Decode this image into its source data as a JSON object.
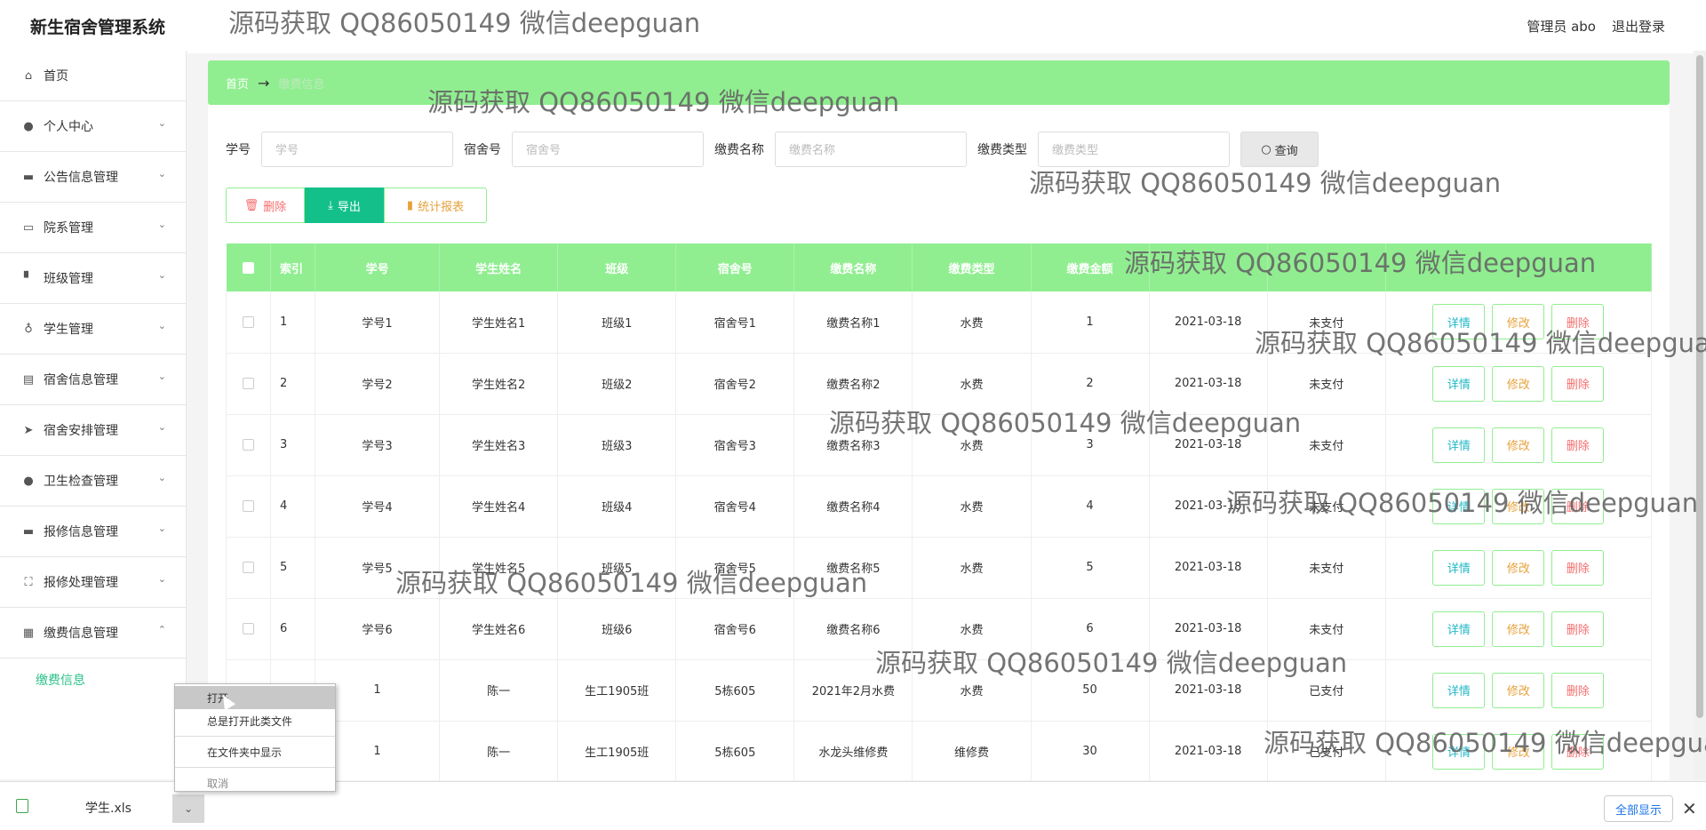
{
  "app_title": "新生宿舍管理系统",
  "header": {
    "user": "管理员 abo",
    "logout": "退出登录"
  },
  "sidebar": {
    "items": [
      {
        "label": "首页",
        "icon": "home-icon"
      },
      {
        "label": "个人中心",
        "icon": "user-icon"
      },
      {
        "label": "公告信息管理",
        "icon": "message-icon"
      },
      {
        "label": "院系管理",
        "icon": "id-card-icon"
      },
      {
        "label": "班级管理",
        "icon": "stamp-icon"
      },
      {
        "label": "学生管理",
        "icon": "microphone-icon"
      },
      {
        "label": "宿舍信息管理",
        "icon": "clipboard-icon"
      },
      {
        "label": "宿舍安排管理",
        "icon": "send-icon"
      },
      {
        "label": "卫生检查管理",
        "icon": "bulb-icon"
      },
      {
        "label": "报修信息管理",
        "icon": "monitor-icon"
      },
      {
        "label": "报修处理管理",
        "icon": "fullscreen-icon"
      },
      {
        "label": "缴费信息管理",
        "icon": "grid-icon"
      }
    ],
    "submenu": "缴费信息"
  },
  "breadcrumb": {
    "home": "首页",
    "separator": "→",
    "current": "缴费信息"
  },
  "search": {
    "fields": [
      {
        "label": "学号",
        "placeholder": "学号"
      },
      {
        "label": "宿舍号",
        "placeholder": "宿舍号"
      },
      {
        "label": "缴费名称",
        "placeholder": "缴费名称"
      },
      {
        "label": "缴费类型",
        "placeholder": "缴费类型"
      }
    ],
    "query_button": "查询"
  },
  "actions": {
    "delete": "删除",
    "export": "导出",
    "stats": "统计报表"
  },
  "table": {
    "headers": [
      "索引",
      "学号",
      "学生姓名",
      "班级",
      "宿舍号",
      "缴费名称",
      "缴费类型",
      "缴费金额",
      "",
      "",
      ""
    ],
    "rows": [
      [
        "1",
        "学号1",
        "学生姓名1",
        "班级1",
        "宿舍号1",
        "缴费名称1",
        "水费",
        "1",
        "2021-03-18",
        "未支付"
      ],
      [
        "2",
        "学号2",
        "学生姓名2",
        "班级2",
        "宿舍号2",
        "缴费名称2",
        "水费",
        "2",
        "2021-03-18",
        "未支付"
      ],
      [
        "3",
        "学号3",
        "学生姓名3",
        "班级3",
        "宿舍号3",
        "缴费名称3",
        "水费",
        "3",
        "2021-03-18",
        "未支付"
      ],
      [
        "4",
        "学号4",
        "学生姓名4",
        "班级4",
        "宿舍号4",
        "缴费名称4",
        "水费",
        "4",
        "2021-03-18",
        "未支付"
      ],
      [
        "5",
        "学号5",
        "学生姓名5",
        "班级5",
        "宿舍号5",
        "缴费名称5",
        "水费",
        "5",
        "2021-03-18",
        "未支付"
      ],
      [
        "6",
        "学号6",
        "学生姓名6",
        "班级6",
        "宿舍号6",
        "缴费名称6",
        "水费",
        "6",
        "2021-03-18",
        "未支付"
      ],
      [
        "",
        "1",
        "陈一",
        "生工1905班",
        "5栋605",
        "2021年2月水费",
        "水费",
        "50",
        "2021-03-18",
        "已支付"
      ],
      [
        "",
        "1",
        "陈一",
        "生工1905班",
        "5栋605",
        "水龙头维修费",
        "维修费",
        "30",
        "2021-03-18",
        "已支付"
      ]
    ],
    "row_actions": {
      "detail": "详情",
      "edit": "修改",
      "delete": "删除"
    }
  },
  "watermark": "源码获取 QQ86050149 微信deepguan",
  "download": {
    "file_name": "学生.xls",
    "show_all": "全部显示",
    "close": "✕"
  },
  "context_menu": {
    "open": "打开",
    "always_open": "总是打开此类文件",
    "show_in_folder": "在文件夹中显示",
    "cancel": "取消"
  }
}
